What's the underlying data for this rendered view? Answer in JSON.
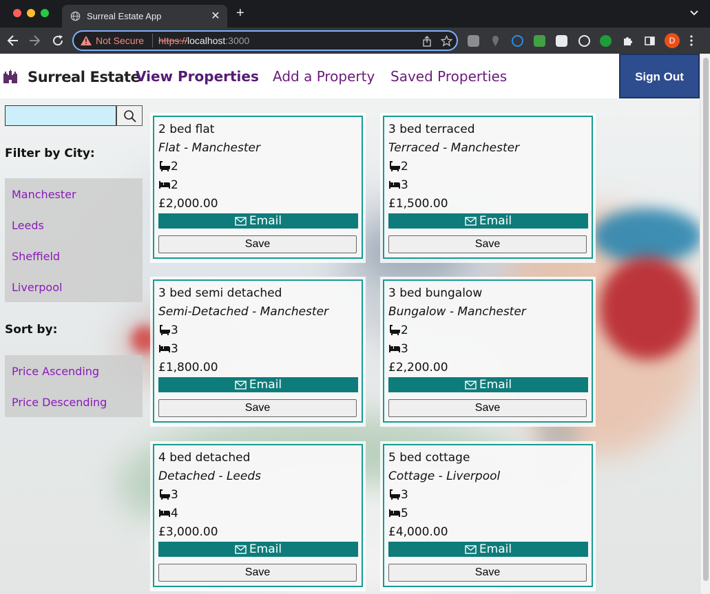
{
  "browser": {
    "tab_title": "Surreal Estate App",
    "not_secure": "Not Secure",
    "url_scheme": "https://",
    "url_host": "localhost",
    "url_port": ":3000",
    "profile_initial": "D"
  },
  "header": {
    "brand": "Surreal Estate",
    "nav": {
      "view": "View Properties",
      "add": "Add a Property",
      "saved": "Saved Properties"
    },
    "sign_out": "Sign Out"
  },
  "sidebar": {
    "search_placeholder": "",
    "filter_heading": "Filter by City:",
    "cities": [
      "Manchester",
      "Leeds",
      "Sheffield",
      "Liverpool"
    ],
    "sort_heading": "Sort by:",
    "sorts": [
      "Price Ascending",
      "Price Descending"
    ]
  },
  "properties": [
    {
      "title": "2 bed flat",
      "type": "Flat - Manchester",
      "bathrooms": "2",
      "bedrooms": "2",
      "price": "£2,000.00",
      "email_label": "Email",
      "save_label": "Save"
    },
    {
      "title": "3 bed terraced",
      "type": "Terraced - Manchester",
      "bathrooms": "2",
      "bedrooms": "3",
      "price": "£1,500.00",
      "email_label": "Email",
      "save_label": "Save"
    },
    {
      "title": "3 bed semi detached",
      "type": "Semi-Detached - Manchester",
      "bathrooms": "3",
      "bedrooms": "3",
      "price": "£1,800.00",
      "email_label": "Email",
      "save_label": "Save"
    },
    {
      "title": "3 bed bungalow",
      "type": "Bungalow - Manchester",
      "bathrooms": "2",
      "bedrooms": "3",
      "price": "£2,200.00",
      "email_label": "Email",
      "save_label": "Save"
    },
    {
      "title": "4 bed detached",
      "type": "Detached - Leeds",
      "bathrooms": "3",
      "bedrooms": "4",
      "price": "£3,000.00",
      "email_label": "Email",
      "save_label": "Save"
    },
    {
      "title": "5 bed cottage",
      "type": "Cottage - Liverpool",
      "bathrooms": "3",
      "bedrooms": "5",
      "price": "£4,000.00",
      "email_label": "Email",
      "save_label": "Save"
    }
  ],
  "colors": {
    "accent_teal": "#0e7c7b",
    "card_border": "#149c92",
    "nav_purple": "#551a75",
    "link_purple": "#8a1ab8",
    "sign_out_bg": "#2e4d8f",
    "search_bg": "#cdeffb"
  },
  "icons": [
    "bath-icon",
    "bed-icon",
    "envelope-icon",
    "search-icon",
    "castle-logo-icon"
  ]
}
